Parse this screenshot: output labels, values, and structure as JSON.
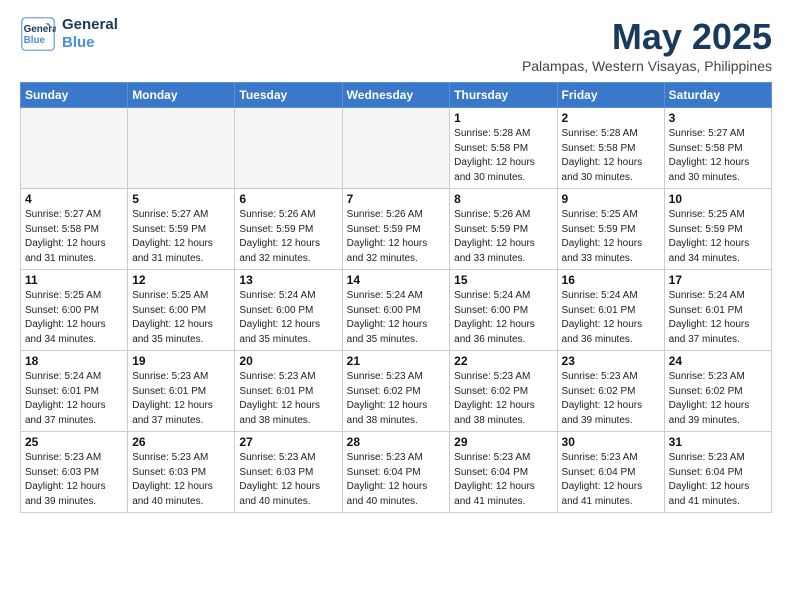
{
  "logo": {
    "line1": "General",
    "line2": "Blue"
  },
  "title": "May 2025",
  "subtitle": "Palampas, Western Visayas, Philippines",
  "weekdays": [
    "Sunday",
    "Monday",
    "Tuesday",
    "Wednesday",
    "Thursday",
    "Friday",
    "Saturday"
  ],
  "weeks": [
    [
      {
        "day": "",
        "info": ""
      },
      {
        "day": "",
        "info": ""
      },
      {
        "day": "",
        "info": ""
      },
      {
        "day": "",
        "info": ""
      },
      {
        "day": "1",
        "info": "Sunrise: 5:28 AM\nSunset: 5:58 PM\nDaylight: 12 hours\nand 30 minutes."
      },
      {
        "day": "2",
        "info": "Sunrise: 5:28 AM\nSunset: 5:58 PM\nDaylight: 12 hours\nand 30 minutes."
      },
      {
        "day": "3",
        "info": "Sunrise: 5:27 AM\nSunset: 5:58 PM\nDaylight: 12 hours\nand 30 minutes."
      }
    ],
    [
      {
        "day": "4",
        "info": "Sunrise: 5:27 AM\nSunset: 5:58 PM\nDaylight: 12 hours\nand 31 minutes."
      },
      {
        "day": "5",
        "info": "Sunrise: 5:27 AM\nSunset: 5:59 PM\nDaylight: 12 hours\nand 31 minutes."
      },
      {
        "day": "6",
        "info": "Sunrise: 5:26 AM\nSunset: 5:59 PM\nDaylight: 12 hours\nand 32 minutes."
      },
      {
        "day": "7",
        "info": "Sunrise: 5:26 AM\nSunset: 5:59 PM\nDaylight: 12 hours\nand 32 minutes."
      },
      {
        "day": "8",
        "info": "Sunrise: 5:26 AM\nSunset: 5:59 PM\nDaylight: 12 hours\nand 33 minutes."
      },
      {
        "day": "9",
        "info": "Sunrise: 5:25 AM\nSunset: 5:59 PM\nDaylight: 12 hours\nand 33 minutes."
      },
      {
        "day": "10",
        "info": "Sunrise: 5:25 AM\nSunset: 5:59 PM\nDaylight: 12 hours\nand 34 minutes."
      }
    ],
    [
      {
        "day": "11",
        "info": "Sunrise: 5:25 AM\nSunset: 6:00 PM\nDaylight: 12 hours\nand 34 minutes."
      },
      {
        "day": "12",
        "info": "Sunrise: 5:25 AM\nSunset: 6:00 PM\nDaylight: 12 hours\nand 35 minutes."
      },
      {
        "day": "13",
        "info": "Sunrise: 5:24 AM\nSunset: 6:00 PM\nDaylight: 12 hours\nand 35 minutes."
      },
      {
        "day": "14",
        "info": "Sunrise: 5:24 AM\nSunset: 6:00 PM\nDaylight: 12 hours\nand 35 minutes."
      },
      {
        "day": "15",
        "info": "Sunrise: 5:24 AM\nSunset: 6:00 PM\nDaylight: 12 hours\nand 36 minutes."
      },
      {
        "day": "16",
        "info": "Sunrise: 5:24 AM\nSunset: 6:01 PM\nDaylight: 12 hours\nand 36 minutes."
      },
      {
        "day": "17",
        "info": "Sunrise: 5:24 AM\nSunset: 6:01 PM\nDaylight: 12 hours\nand 37 minutes."
      }
    ],
    [
      {
        "day": "18",
        "info": "Sunrise: 5:24 AM\nSunset: 6:01 PM\nDaylight: 12 hours\nand 37 minutes."
      },
      {
        "day": "19",
        "info": "Sunrise: 5:23 AM\nSunset: 6:01 PM\nDaylight: 12 hours\nand 37 minutes."
      },
      {
        "day": "20",
        "info": "Sunrise: 5:23 AM\nSunset: 6:01 PM\nDaylight: 12 hours\nand 38 minutes."
      },
      {
        "day": "21",
        "info": "Sunrise: 5:23 AM\nSunset: 6:02 PM\nDaylight: 12 hours\nand 38 minutes."
      },
      {
        "day": "22",
        "info": "Sunrise: 5:23 AM\nSunset: 6:02 PM\nDaylight: 12 hours\nand 38 minutes."
      },
      {
        "day": "23",
        "info": "Sunrise: 5:23 AM\nSunset: 6:02 PM\nDaylight: 12 hours\nand 39 minutes."
      },
      {
        "day": "24",
        "info": "Sunrise: 5:23 AM\nSunset: 6:02 PM\nDaylight: 12 hours\nand 39 minutes."
      }
    ],
    [
      {
        "day": "25",
        "info": "Sunrise: 5:23 AM\nSunset: 6:03 PM\nDaylight: 12 hours\nand 39 minutes."
      },
      {
        "day": "26",
        "info": "Sunrise: 5:23 AM\nSunset: 6:03 PM\nDaylight: 12 hours\nand 40 minutes."
      },
      {
        "day": "27",
        "info": "Sunrise: 5:23 AM\nSunset: 6:03 PM\nDaylight: 12 hours\nand 40 minutes."
      },
      {
        "day": "28",
        "info": "Sunrise: 5:23 AM\nSunset: 6:04 PM\nDaylight: 12 hours\nand 40 minutes."
      },
      {
        "day": "29",
        "info": "Sunrise: 5:23 AM\nSunset: 6:04 PM\nDaylight: 12 hours\nand 41 minutes."
      },
      {
        "day": "30",
        "info": "Sunrise: 5:23 AM\nSunset: 6:04 PM\nDaylight: 12 hours\nand 41 minutes."
      },
      {
        "day": "31",
        "info": "Sunrise: 5:23 AM\nSunset: 6:04 PM\nDaylight: 12 hours\nand 41 minutes."
      }
    ]
  ]
}
